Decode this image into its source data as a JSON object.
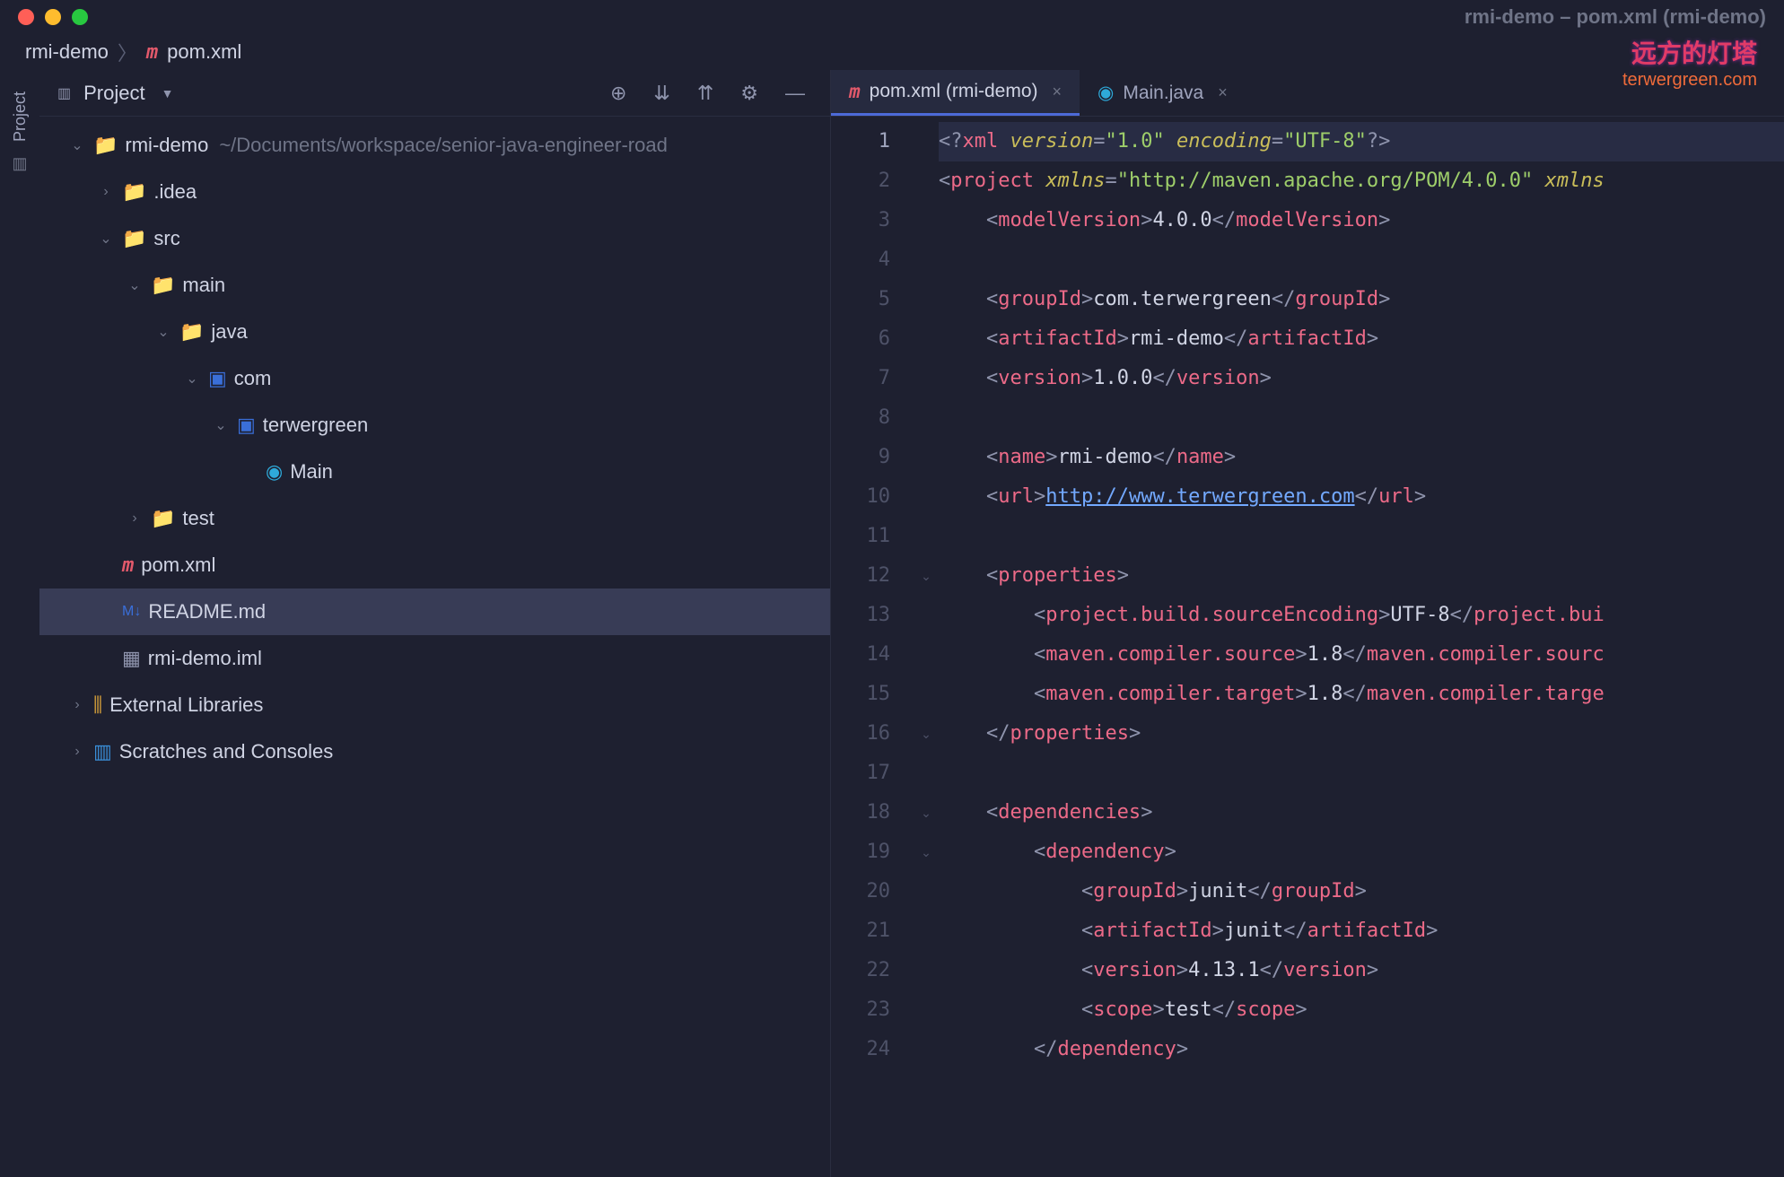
{
  "window_title": "rmi-demo – pom.xml (rmi-demo)",
  "watermark": {
    "cn": "远方的灯塔",
    "en": "terwergreen.com"
  },
  "breadcrumb": {
    "root": "rmi-demo",
    "file": "pom.xml"
  },
  "left_rail_label": "Project",
  "panel": {
    "title": "Project"
  },
  "tools": {
    "target": "⊕",
    "expand": "⇱",
    "collapse": "⇲",
    "gear": "⚙",
    "hide": "—"
  },
  "tree": [
    {
      "depth": 0,
      "arrow": "v",
      "icon": "folder",
      "label": "rmi-demo",
      "path": "~/Documents/workspace/senior-java-engineer-road"
    },
    {
      "depth": 1,
      "arrow": ">",
      "icon": "folder",
      "label": ".idea"
    },
    {
      "depth": 1,
      "arrow": "v",
      "icon": "folder",
      "label": "src"
    },
    {
      "depth": 2,
      "arrow": "v",
      "icon": "folder",
      "label": "main"
    },
    {
      "depth": 3,
      "arrow": "v",
      "icon": "folder",
      "label": "java"
    },
    {
      "depth": 4,
      "arrow": "v",
      "icon": "pkg",
      "label": "com"
    },
    {
      "depth": 5,
      "arrow": "v",
      "icon": "pkg",
      "label": "terwergreen"
    },
    {
      "depth": 6,
      "arrow": "",
      "icon": "class",
      "label": "Main"
    },
    {
      "depth": 2,
      "arrow": ">",
      "icon": "folder",
      "label": "test"
    },
    {
      "depth": 1,
      "arrow": "",
      "icon": "m",
      "label": "pom.xml"
    },
    {
      "depth": 1,
      "arrow": "",
      "icon": "md",
      "label": "README.md",
      "selected": true
    },
    {
      "depth": 1,
      "arrow": "",
      "icon": "iml",
      "label": "rmi-demo.iml"
    },
    {
      "depth": 0,
      "arrow": ">",
      "icon": "lib",
      "label": "External Libraries"
    },
    {
      "depth": 0,
      "arrow": ">",
      "icon": "scratch",
      "label": "Scratches and Consoles"
    }
  ],
  "tabs": [
    {
      "icon": "m",
      "label": "pom.xml (rmi-demo)",
      "active": true
    },
    {
      "icon": "class",
      "label": "Main.java",
      "active": false
    }
  ],
  "code_lines": [
    {
      "n": 1,
      "hl": true,
      "html": "<span class='p'>&lt;?</span><span class='tg'>xml</span> <span class='atI'>version</span><span class='p'>=</span><span class='st'>\"1.0\"</span> <span class='atI'>encoding</span><span class='p'>=</span><span class='st'>\"UTF-8\"</span><span class='p'>?&gt;</span>"
    },
    {
      "n": 2,
      "html": "<span class='p'>&lt;</span><span class='tg'>project</span> <span class='atI'>xmlns</span><span class='p'>=</span><span class='st'>\"http://maven.apache.org/POM/4.0.0\"</span> <span class='atI'>xmlns</span>"
    },
    {
      "n": 3,
      "html": "    <span class='p'>&lt;</span><span class='tg'>modelVersion</span><span class='p'>&gt;</span><span class='tx'>4.0.0</span><span class='p'>&lt;/</span><span class='tg'>modelVersion</span><span class='p'>&gt;</span>"
    },
    {
      "n": 4,
      "html": ""
    },
    {
      "n": 5,
      "html": "    <span class='p'>&lt;</span><span class='tg'>groupId</span><span class='p'>&gt;</span><span class='tx'>com.terwergreen</span><span class='p'>&lt;/</span><span class='tg'>groupId</span><span class='p'>&gt;</span>"
    },
    {
      "n": 6,
      "html": "    <span class='p'>&lt;</span><span class='tg'>artifactId</span><span class='p'>&gt;</span><span class='tx'>rmi-demo</span><span class='p'>&lt;/</span><span class='tg'>artifactId</span><span class='p'>&gt;</span>"
    },
    {
      "n": 7,
      "html": "    <span class='p'>&lt;</span><span class='tg'>version</span><span class='p'>&gt;</span><span class='tx'>1.0.0</span><span class='p'>&lt;/</span><span class='tg'>version</span><span class='p'>&gt;</span>"
    },
    {
      "n": 8,
      "html": ""
    },
    {
      "n": 9,
      "html": "    <span class='p'>&lt;</span><span class='tg'>name</span><span class='p'>&gt;</span><span class='tx'>rmi-demo</span><span class='p'>&lt;/</span><span class='tg'>name</span><span class='p'>&gt;</span>"
    },
    {
      "n": 10,
      "html": "    <span class='p'>&lt;</span><span class='tg'>url</span><span class='p'>&gt;</span><span class='lk'>http://www.terwergreen.com</span><span class='p'>&lt;/</span><span class='tg'>url</span><span class='p'>&gt;</span>"
    },
    {
      "n": 11,
      "html": ""
    },
    {
      "n": 12,
      "fold": true,
      "html": "    <span class='p'>&lt;</span><span class='tg'>properties</span><span class='p'>&gt;</span>"
    },
    {
      "n": 13,
      "html": "        <span class='p'>&lt;</span><span class='tg'>project.build.sourceEncoding</span><span class='p'>&gt;</span><span class='tx'>UTF-8</span><span class='p'>&lt;/</span><span class='tg'>project.bui</span>"
    },
    {
      "n": 14,
      "html": "        <span class='p'>&lt;</span><span class='tg'>maven.compiler.source</span><span class='p'>&gt;</span><span class='tx'>1.8</span><span class='p'>&lt;/</span><span class='tg'>maven.compiler.sourc</span>"
    },
    {
      "n": 15,
      "html": "        <span class='p'>&lt;</span><span class='tg'>maven.compiler.target</span><span class='p'>&gt;</span><span class='tx'>1.8</span><span class='p'>&lt;/</span><span class='tg'>maven.compiler.targe</span>"
    },
    {
      "n": 16,
      "fold": true,
      "html": "    <span class='p'>&lt;/</span><span class='tg'>properties</span><span class='p'>&gt;</span>"
    },
    {
      "n": 17,
      "html": ""
    },
    {
      "n": 18,
      "fold": true,
      "html": "    <span class='p'>&lt;</span><span class='tg'>dependencies</span><span class='p'>&gt;</span>"
    },
    {
      "n": 19,
      "fold": true,
      "html": "        <span class='p'>&lt;</span><span class='tg'>dependency</span><span class='p'>&gt;</span>"
    },
    {
      "n": 20,
      "html": "            <span class='p'>&lt;</span><span class='tg'>groupId</span><span class='p'>&gt;</span><span class='tx'>junit</span><span class='p'>&lt;/</span><span class='tg'>groupId</span><span class='p'>&gt;</span>"
    },
    {
      "n": 21,
      "html": "            <span class='p'>&lt;</span><span class='tg'>artifactId</span><span class='p'>&gt;</span><span class='tx'>junit</span><span class='p'>&lt;/</span><span class='tg'>artifactId</span><span class='p'>&gt;</span>"
    },
    {
      "n": 22,
      "html": "            <span class='p'>&lt;</span><span class='tg'>version</span><span class='p'>&gt;</span><span class='tx'>4.13.1</span><span class='p'>&lt;/</span><span class='tg'>version</span><span class='p'>&gt;</span>"
    },
    {
      "n": 23,
      "html": "            <span class='p'>&lt;</span><span class='tg'>scope</span><span class='p'>&gt;</span><span class='tx'>test</span><span class='p'>&lt;/</span><span class='tg'>scope</span><span class='p'>&gt;</span>"
    },
    {
      "n": 24,
      "html": "        <span class='p'>&lt;/</span><span class='tg'>dependency</span><span class='p'>&gt;</span>"
    }
  ]
}
